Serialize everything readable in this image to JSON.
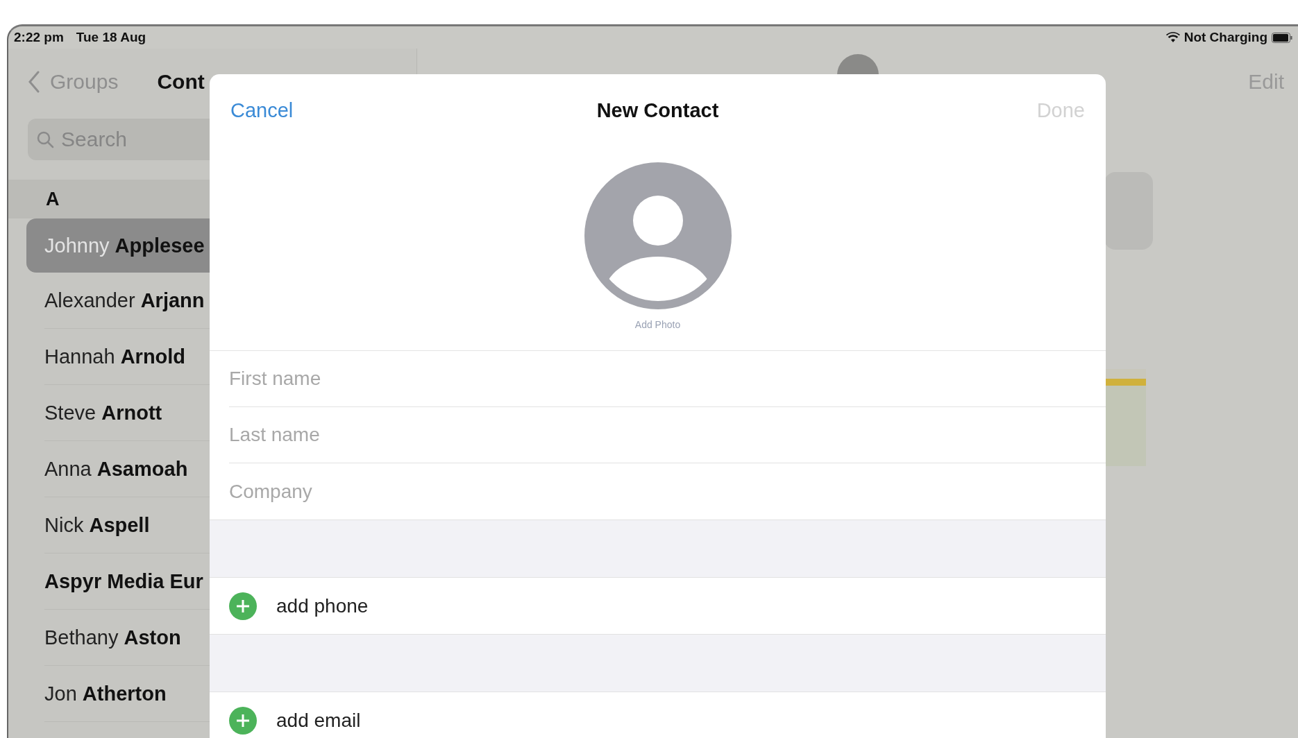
{
  "status_bar": {
    "time": "2:22 pm",
    "date": "Tue 18 Aug",
    "battery_label": "Not Charging"
  },
  "sidebar": {
    "back_label": "Groups",
    "title": "Cont",
    "search": {
      "placeholder": "Search"
    },
    "section": "A",
    "contacts": [
      {
        "name": "Johnny **Applesee**",
        "kind": "person",
        "selected": true
      },
      {
        "name": "Alexander **Arjann**",
        "kind": "person",
        "selected": false
      },
      {
        "name": "Hannah **Arnold**",
        "kind": "person",
        "selected": false
      },
      {
        "name": "Steve **Arnott**",
        "kind": "person",
        "selected": false
      },
      {
        "name": "Anna **Asamoah**",
        "kind": "person",
        "selected": false
      },
      {
        "name": "Nick **Aspell**",
        "kind": "person",
        "selected": false
      },
      {
        "name": "Aspyr Media Eur",
        "kind": "company",
        "selected": false
      },
      {
        "name": "Bethany **Aston**",
        "kind": "person",
        "selected": false
      },
      {
        "name": "Jon **Atherton**",
        "kind": "person",
        "selected": false
      }
    ]
  },
  "detail": {
    "edit_label": "Edit"
  },
  "modal": {
    "cancel": "Cancel",
    "title": "New Contact",
    "done": {
      "label": "Done",
      "disabled": true
    },
    "add_photo": "Add Photo",
    "fields": [
      {
        "placeholder": "First name"
      },
      {
        "placeholder": "Last name"
      },
      {
        "placeholder": "Company"
      }
    ],
    "actions": [
      {
        "label": "add phone"
      },
      {
        "label": "add email"
      }
    ]
  }
}
